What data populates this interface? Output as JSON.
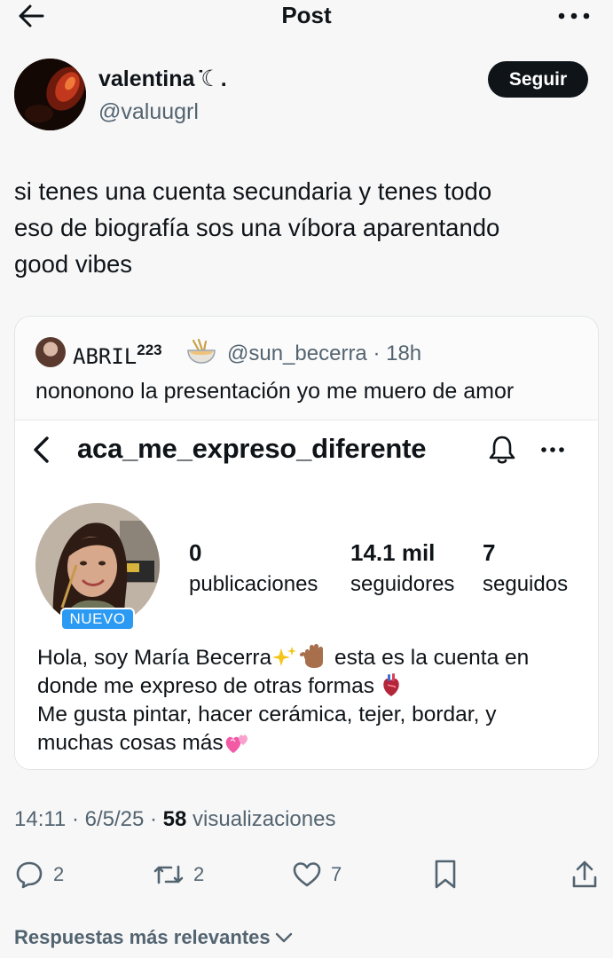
{
  "header": {
    "title": "Post"
  },
  "author": {
    "display_name": "valentina ̇☾.",
    "handle": "@valuugrl",
    "follow_label": "Seguir"
  },
  "tweet": {
    "lines": [
      "si tenes una cuenta secundaria y tenes todo",
      "eso de biografía sos una víbora aparentando",
      "good vibes"
    ]
  },
  "quote": {
    "name": "ABRIL",
    "name_sup": "223",
    "handle_time": "@sun_becerra · 18h",
    "text": "nononono la presentación yo me muero de amor",
    "profile": {
      "username": "aca_me_expreso_diferente",
      "badge": "NUEVO",
      "stats": [
        {
          "num": "0",
          "label": "publicaciones"
        },
        {
          "num": "14.1 mil",
          "label": "seguidores"
        },
        {
          "num": "7",
          "label": "seguidos"
        }
      ],
      "bio": {
        "line1_a": "Hola, soy María Becerra",
        "line1_b": "esta es la cuenta en",
        "line2": "donde me expreso de otras formas",
        "line3": "Me gusta pintar, hacer cerámica, tejer, bordar, y",
        "line4": "muchas cosas más"
      }
    }
  },
  "meta": {
    "time_date": "14:11 · 6/5/25 · ",
    "views_count": "58",
    "views_label": " visualizaciones"
  },
  "actions": {
    "replies": "2",
    "reposts": "2",
    "likes": "7"
  },
  "replies_sort": {
    "label": "Respuestas más relevantes"
  },
  "colors": {
    "follow_bg": "#0f1419",
    "badge": "#2b9af3",
    "muted": "#536471"
  }
}
